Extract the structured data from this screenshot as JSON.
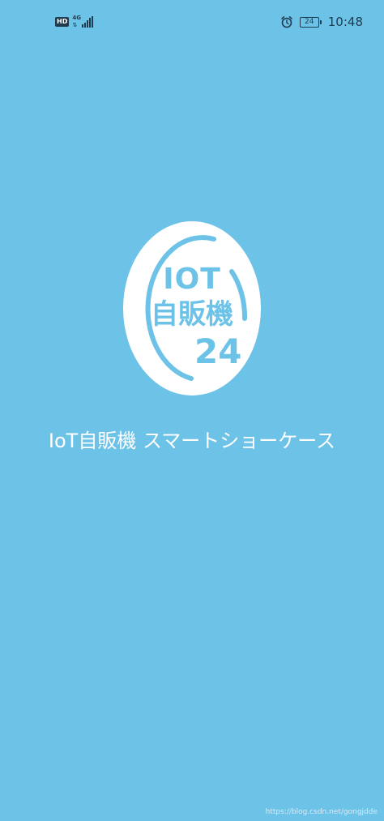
{
  "status_bar": {
    "hd_label": "HD",
    "network_label": "4G",
    "network_arrows": "⇅",
    "battery_level": "24",
    "time": "10:48"
  },
  "logo": {
    "line1": "IOT",
    "line2": "自販機",
    "number": "24"
  },
  "app_title": "IoT自販機 スマートショーケース",
  "watermark": "https://blog.csdn.net/gongjdde",
  "colors": {
    "background": "#6dc2e8",
    "logo_circle": "#ffffff",
    "logo_accent": "#6dc2e8",
    "status_icons": "#1f3b4d",
    "title_text": "#ffffff"
  }
}
